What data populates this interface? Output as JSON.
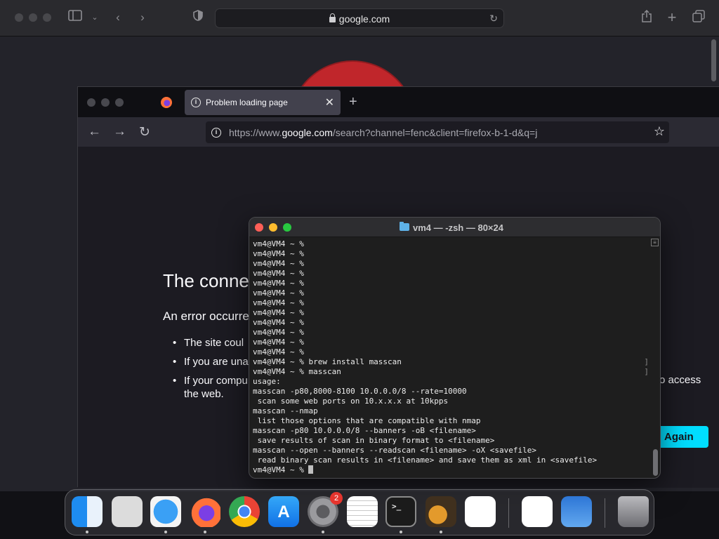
{
  "safari": {
    "address": "google.com"
  },
  "firefox": {
    "tab_title": "Problem loading page",
    "url_prefix": "https://www.",
    "url_domain": "google.com",
    "url_rest": "/search?channel=fenc&client=firefox-b-1-d&q=j",
    "error_title": "The connec",
    "error_description": "An error occurre",
    "error_bullets": [
      "The site coul",
      "If you are una",
      "If your compu"
    ],
    "error_bullet3_cont": "the web.",
    "error_right_text": "o access",
    "try_again_label": "Again"
  },
  "terminal": {
    "title": "vm4 — -zsh — 80×24",
    "lines": [
      "vm4@VM4 ~ %",
      "vm4@VM4 ~ %",
      "vm4@VM4 ~ %",
      "vm4@VM4 ~ %",
      "vm4@VM4 ~ %",
      "vm4@VM4 ~ %",
      "vm4@VM4 ~ %",
      "vm4@VM4 ~ %",
      "vm4@VM4 ~ %",
      "vm4@VM4 ~ %",
      "vm4@VM4 ~ %",
      "vm4@VM4 ~ %",
      "vm4@VM4 ~ % brew install masscan",
      "vm4@VM4 ~ % masscan",
      "usage:",
      "masscan -p80,8000-8100 10.0.0.0/8 --rate=10000",
      " scan some web ports on 10.x.x.x at 10kpps",
      "masscan --nmap",
      " list those options that are compatible with nmap",
      "masscan -p80 10.0.0.0/8 --banners -oB <filename>",
      " save results of scan in binary format to <filename>",
      "masscan --open --banners --readscan <filename> -oX <savefile>",
      " read binary scan results in <filename> and save them as xml in <savefile>"
    ],
    "prompt": "vm4@VM4 ~ % "
  },
  "dock": {
    "apps": [
      {
        "name": "Finder",
        "icon": "finder-icon",
        "running": true
      },
      {
        "name": "Launchpad",
        "icon": "launchpad-icon",
        "running": false
      },
      {
        "name": "Safari",
        "icon": "safari-icon",
        "running": true
      },
      {
        "name": "Firefox",
        "icon": "firefox-icon",
        "running": true
      },
      {
        "name": "Chrome",
        "icon": "chrome-icon",
        "running": false
      },
      {
        "name": "App Store",
        "icon": "app-store-icon",
        "running": false
      },
      {
        "name": "System Settings",
        "icon": "settings-icon",
        "running": true,
        "badge": "2"
      },
      {
        "name": "TextEdit",
        "icon": "textedit-icon",
        "running": false
      },
      {
        "name": "Terminal",
        "icon": "terminal-icon",
        "running": true
      },
      {
        "name": "GarageBand",
        "icon": "garageband-icon",
        "running": true
      },
      {
        "name": "VS Code",
        "icon": "vscode-icon",
        "running": false
      },
      {
        "name": "Visual Studio",
        "icon": "visual-studio-icon",
        "running": false
      },
      {
        "name": "Weather",
        "icon": "weather-icon",
        "running": false
      },
      {
        "name": "Trash",
        "icon": "trash-icon",
        "running": false
      }
    ]
  },
  "colors": {
    "accent": "#00ddff",
    "terminal_bg": "#1e1e1e",
    "firefox_bg": "#1c1b22"
  }
}
